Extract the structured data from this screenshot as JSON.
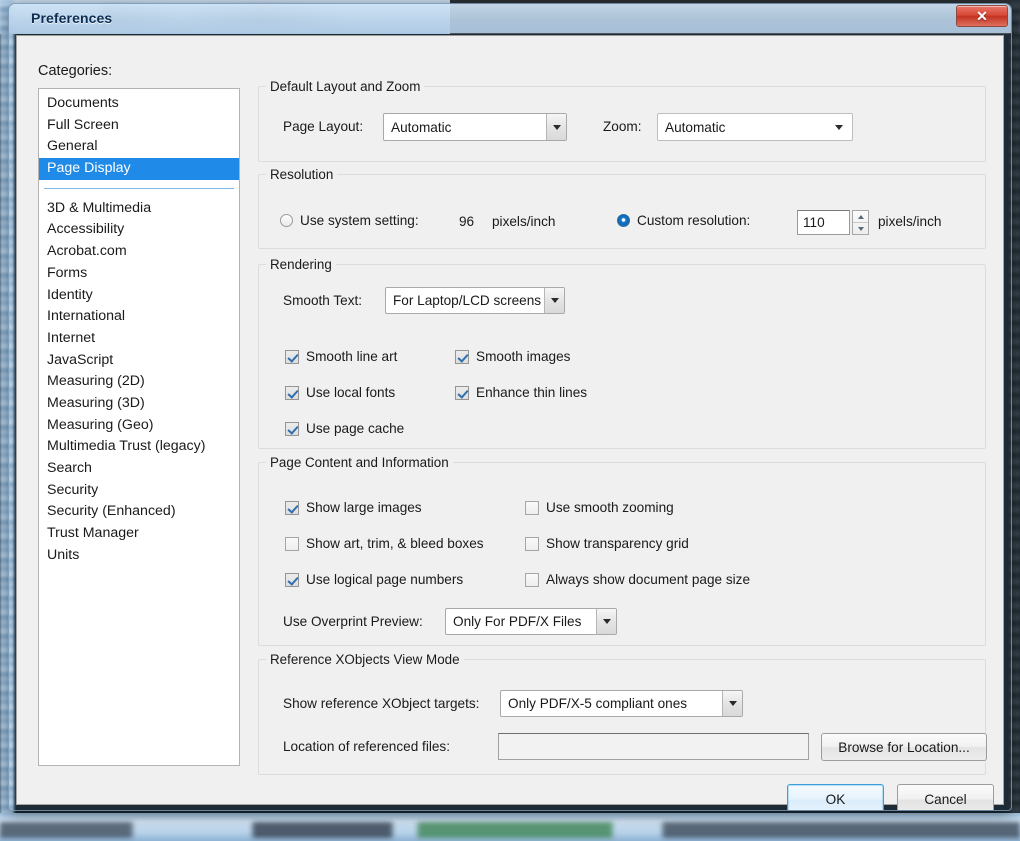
{
  "window": {
    "title": "Preferences",
    "close_label": "✕"
  },
  "sidebar": {
    "heading": "Categories:",
    "items_top": [
      {
        "label": "Documents",
        "selected": false
      },
      {
        "label": "Full Screen",
        "selected": false
      },
      {
        "label": "General",
        "selected": false
      },
      {
        "label": "Page Display",
        "selected": true
      }
    ],
    "items_bottom": [
      {
        "label": "3D & Multimedia"
      },
      {
        "label": "Accessibility"
      },
      {
        "label": "Acrobat.com"
      },
      {
        "label": "Forms"
      },
      {
        "label": "Identity"
      },
      {
        "label": "International"
      },
      {
        "label": "Internet"
      },
      {
        "label": "JavaScript"
      },
      {
        "label": "Measuring (2D)"
      },
      {
        "label": "Measuring (3D)"
      },
      {
        "label": "Measuring (Geo)"
      },
      {
        "label": "Multimedia Trust (legacy)"
      },
      {
        "label": "Search"
      },
      {
        "label": "Security"
      },
      {
        "label": "Security (Enhanced)"
      },
      {
        "label": "Trust Manager"
      },
      {
        "label": "Units"
      }
    ]
  },
  "layout_group": {
    "title": "Default Layout and Zoom",
    "page_layout_label": "Page Layout:",
    "page_layout_value": "Automatic",
    "zoom_label": "Zoom:",
    "zoom_value": "Automatic"
  },
  "resolution_group": {
    "title": "Resolution",
    "system_radio_label": "Use system setting:",
    "system_radio_selected": false,
    "system_value": "96",
    "system_units": "pixels/inch",
    "custom_radio_label": "Custom resolution:",
    "custom_radio_selected": true,
    "custom_value": "110",
    "custom_units": "pixels/inch"
  },
  "rendering_group": {
    "title": "Rendering",
    "smooth_text_label": "Smooth Text:",
    "smooth_text_value": "For Laptop/LCD screens",
    "checkboxes": [
      {
        "label": "Smooth line art",
        "checked": true
      },
      {
        "label": "Smooth images",
        "checked": true
      },
      {
        "label": "Use local fonts",
        "checked": true
      },
      {
        "label": "Enhance thin lines",
        "checked": true
      },
      {
        "label": "Use page cache",
        "checked": true
      }
    ]
  },
  "page_content_group": {
    "title": "Page Content and Information",
    "checkboxes": [
      {
        "label": "Show large images",
        "checked": true
      },
      {
        "label": "Use smooth zooming",
        "checked": false
      },
      {
        "label": "Show art, trim, & bleed boxes",
        "checked": false
      },
      {
        "label": "Show transparency grid",
        "checked": false
      },
      {
        "label": "Use logical page numbers",
        "checked": true
      },
      {
        "label": "Always show document page size",
        "checked": false
      }
    ],
    "overprint_label": "Use Overprint Preview:",
    "overprint_value": "Only For PDF/X Files"
  },
  "xobjects_group": {
    "title": "Reference XObjects View Mode",
    "targets_label": "Show reference XObject targets:",
    "targets_value": "Only PDF/X-5 compliant ones",
    "location_label": "Location of referenced files:",
    "location_value": "",
    "browse_label": "Browse for Location..."
  },
  "footer": {
    "ok_label": "OK",
    "cancel_label": "Cancel"
  },
  "colors": {
    "selection": "#1f8ae8",
    "accent_border": "#3c9ede",
    "close_red": "#d84a38"
  }
}
